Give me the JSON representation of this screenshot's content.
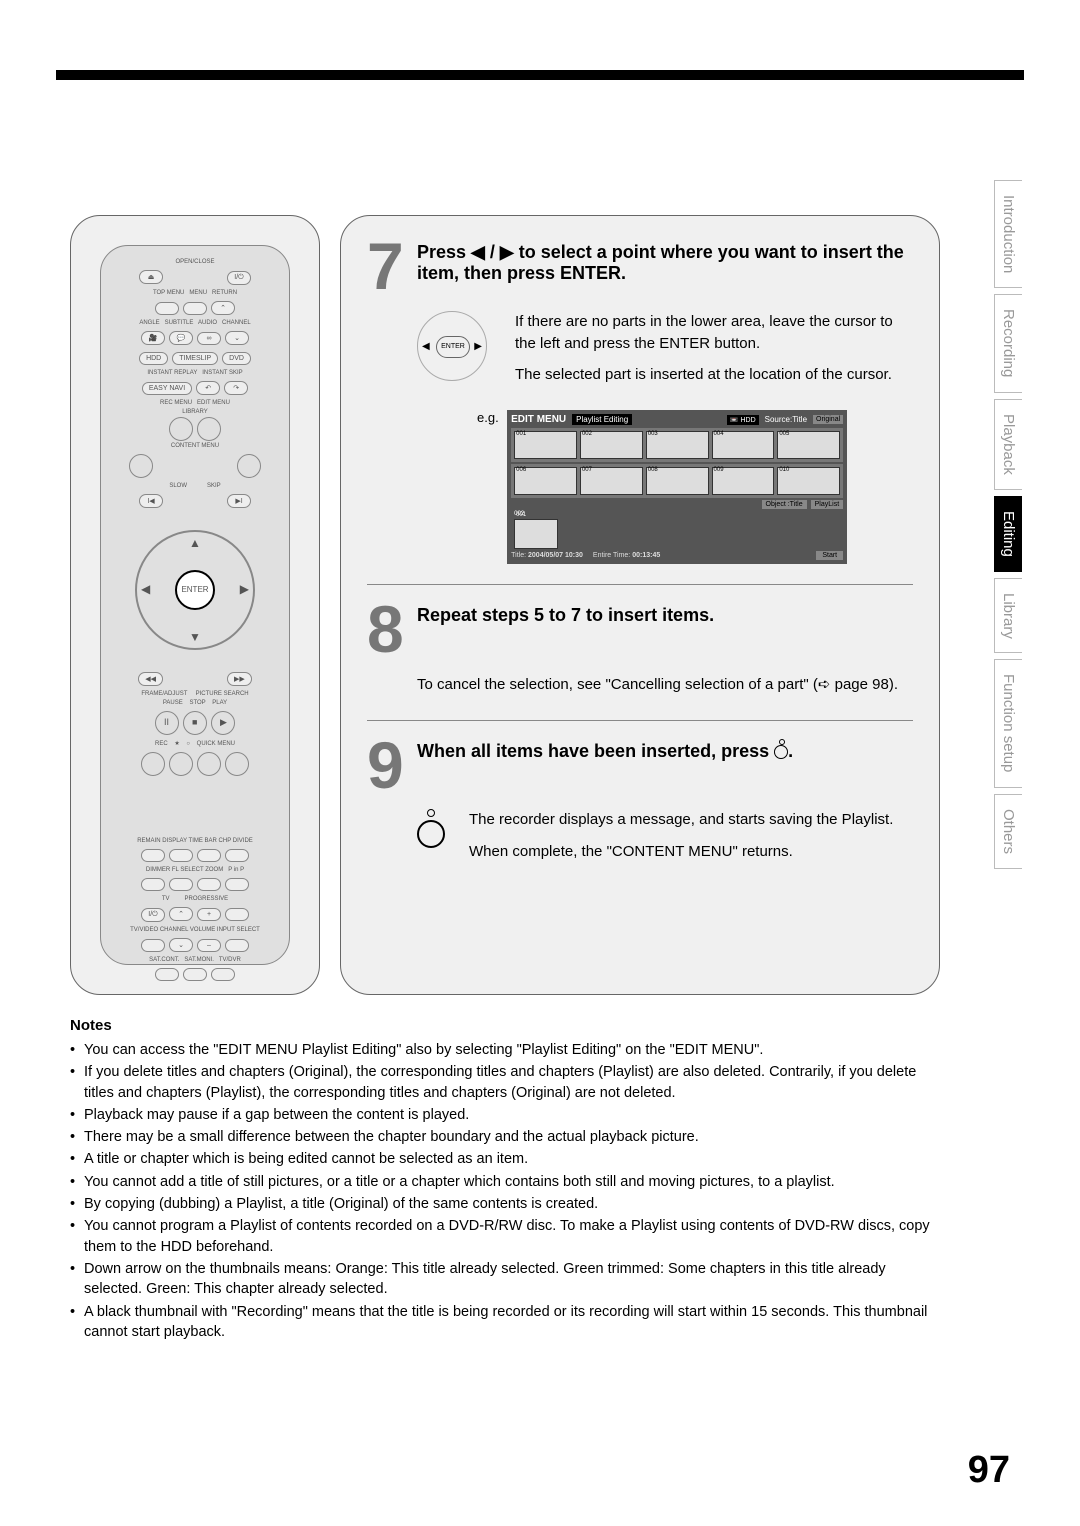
{
  "page_number": "97",
  "side_tabs": [
    "Introduction",
    "Recording",
    "Playback",
    "Editing",
    "Library",
    "Function setup",
    "Others"
  ],
  "active_tab_index": 3,
  "remote": {
    "enter": "ENTER"
  },
  "step7": {
    "num": "7",
    "title_a": "Press ",
    "title_b": " to select a point where you want to insert the item, then press ENTER.",
    "arrows": "◀ / ▶",
    "body1": "If there are no parts in the lower area, leave the cursor to the left and press the ENTER button.",
    "body2": "The selected part is inserted at the location of the cursor.",
    "eg_label": "e.g.",
    "dpad_center": "ENTER"
  },
  "screen": {
    "edit_menu": "EDIT MENU",
    "playlist_editing": "Playlist Editing",
    "hdd": "HDD",
    "source_title": "Source:Title",
    "original": "Original",
    "thumbs_row1": [
      "001",
      "002",
      "003",
      "004",
      "005"
    ],
    "thumbs_row2": [
      "006",
      "007",
      "008",
      "009",
      "010"
    ],
    "object_title": "Object :Title",
    "playlist": "PlayList",
    "low_thumb": "002",
    "low_sub": "001",
    "title_label": "Title:",
    "title_val": "2004/05/07  10:30",
    "entire_label": "Entire Time:",
    "entire_val": "00:13:45",
    "start": "Start"
  },
  "step8": {
    "num": "8",
    "title": "Repeat steps 5 to 7 to insert items.",
    "body_a": "To cancel the selection, see \"Cancelling selection of a part\" (",
    "body_b": " page 98).",
    "arrow": "➪"
  },
  "step9": {
    "num": "9",
    "title": "When all items have been inserted, press ",
    "title_suffix": ".",
    "body1": "The recorder displays a message, and starts saving the Playlist.",
    "body2": "When complete, the \"CONTENT MENU\" returns."
  },
  "notes": {
    "heading": "Notes",
    "items": [
      "You can access the \"EDIT MENU Playlist Editing\" also by selecting \"Playlist Editing\" on the \"EDIT MENU\".",
      "If you delete titles and chapters (Original), the corresponding titles and chapters (Playlist) are also deleted. Contrarily, if you delete titles and chapters (Playlist), the corresponding titles and chapters (Original) are not deleted.",
      "Playback may pause if a gap between the content is played.",
      "There may be a small difference between the chapter boundary and the actual playback picture.",
      "A title or chapter which is being edited cannot be selected as an item.",
      "You cannot add a title of still pictures, or a title or a chapter which contains both still and moving pictures, to a playlist.",
      "By copying (dubbing) a Playlist, a title (Original) of the same contents is created.",
      "You cannot program a Playlist of contents recorded on a DVD-R/RW disc. To make a Playlist using contents of DVD-RW discs, copy them to the HDD beforehand.",
      "Down arrow on the thumbnails means: Orange: This title already selected. Green trimmed: Some chapters in this title already selected.  Green: This chapter already selected.",
      "A black thumbnail with \"Recording\" means that the title is being recorded or its recording will start within 15 seconds. This thumbnail cannot start playback."
    ]
  }
}
